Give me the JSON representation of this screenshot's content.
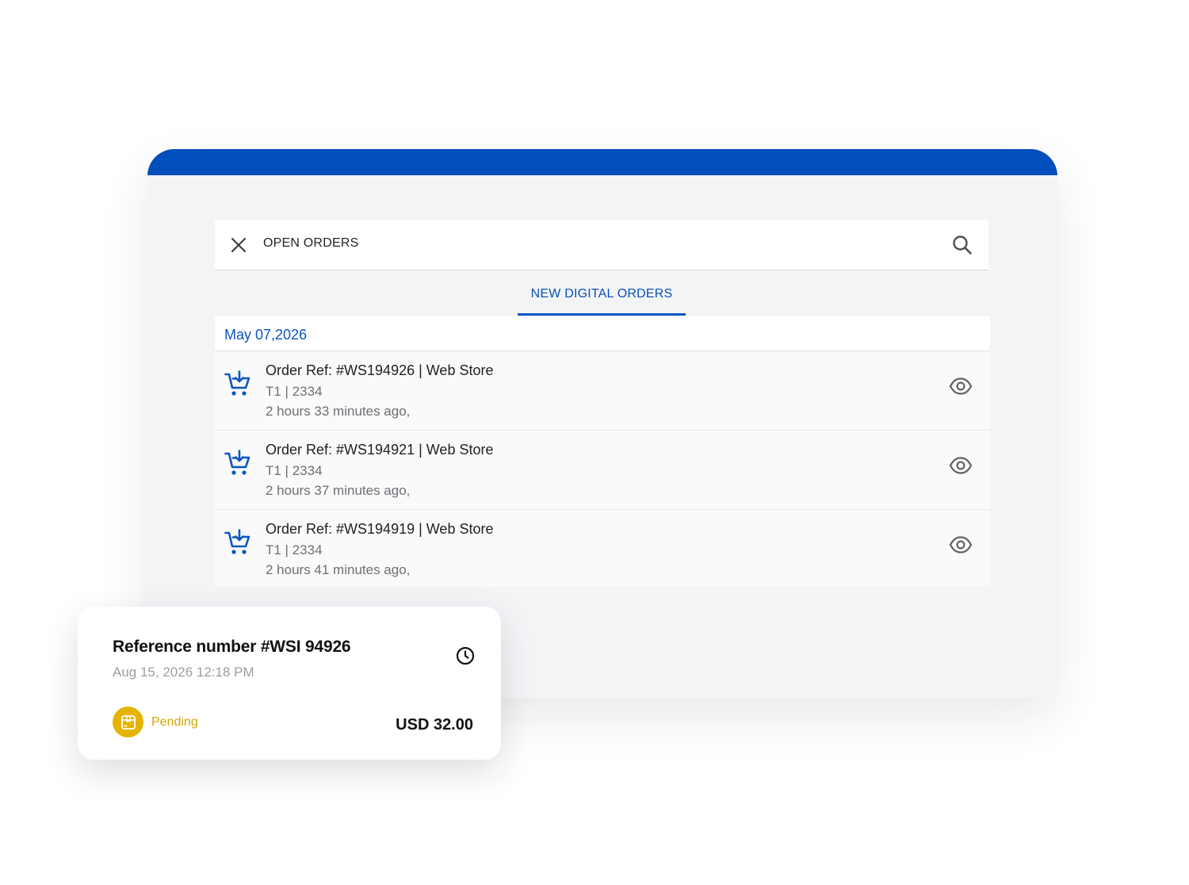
{
  "colors": {
    "brand_blue": "#014ebd",
    "pending_yellow": "#e4b400"
  },
  "header": {
    "title": "OPEN ORDERS",
    "close_icon": "close-icon",
    "search_icon": "search-icon"
  },
  "tabs": [
    {
      "label": "NEW DIGITAL ORDERS",
      "active": true
    }
  ],
  "order_list": {
    "date": "May 07,2026",
    "orders": [
      {
        "title": "Order Ref: #WS194926 | Web Store",
        "sub": "T1 | 2334",
        "time": "2 hours 33 minutes ago,",
        "icon": "cart-download-icon",
        "action_icon": "eye-icon"
      },
      {
        "title": "Order Ref: #WS194921 | Web Store",
        "sub": "T1 | 2334",
        "time": "2 hours 37 minutes ago,",
        "icon": "cart-download-icon",
        "action_icon": "eye-icon"
      },
      {
        "title": "Order Ref: #WS194919 | Web Store",
        "sub": "T1 | 2334",
        "time": "2 hours 41 minutes ago,",
        "icon": "cart-download-icon",
        "action_icon": "eye-icon"
      }
    ]
  },
  "reference_card": {
    "title": "Reference number #WSI 94926",
    "date": "Aug 15, 2026 12:18 PM",
    "status": "Pending",
    "amount": "USD 32.00",
    "clock_icon": "clock-icon",
    "status_icon": "package-icon"
  }
}
